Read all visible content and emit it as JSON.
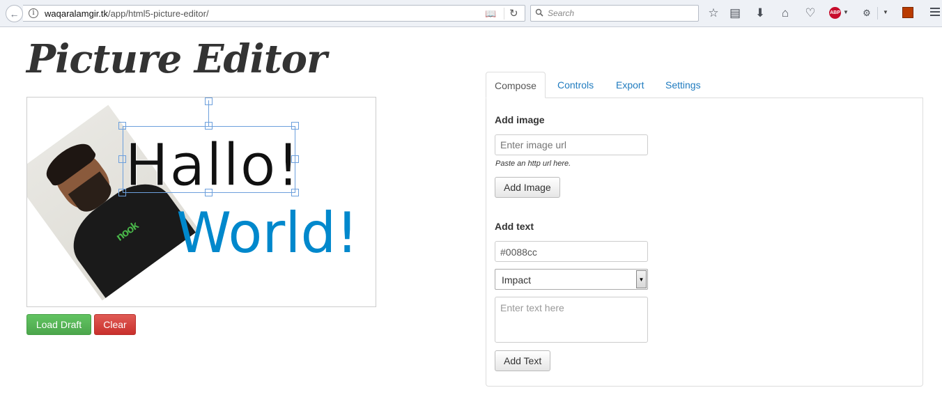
{
  "browser": {
    "url_domain": "waqaralamgir.tk",
    "url_path": "/app/html5-picture-editor/",
    "search_placeholder": "Search",
    "abp_label": "ABP"
  },
  "page": {
    "title": "Picture Editor"
  },
  "canvas": {
    "text_hallo": "Hallo!",
    "text_world": "World!",
    "shirt_logo": "nook",
    "world_color": "#0088cc"
  },
  "actions": {
    "load_draft": "Load Draft",
    "clear": "Clear"
  },
  "tabs": [
    "Compose",
    "Controls",
    "Export",
    "Settings"
  ],
  "compose": {
    "add_image_title": "Add image",
    "image_url_placeholder": "Enter image url",
    "image_url_help": "Paste an http url here.",
    "add_image_button": "Add Image",
    "add_text_title": "Add text",
    "color_value": "#0088cc",
    "font_selected": "Impact",
    "text_placeholder": "Enter text here",
    "add_text_button": "Add Text"
  }
}
